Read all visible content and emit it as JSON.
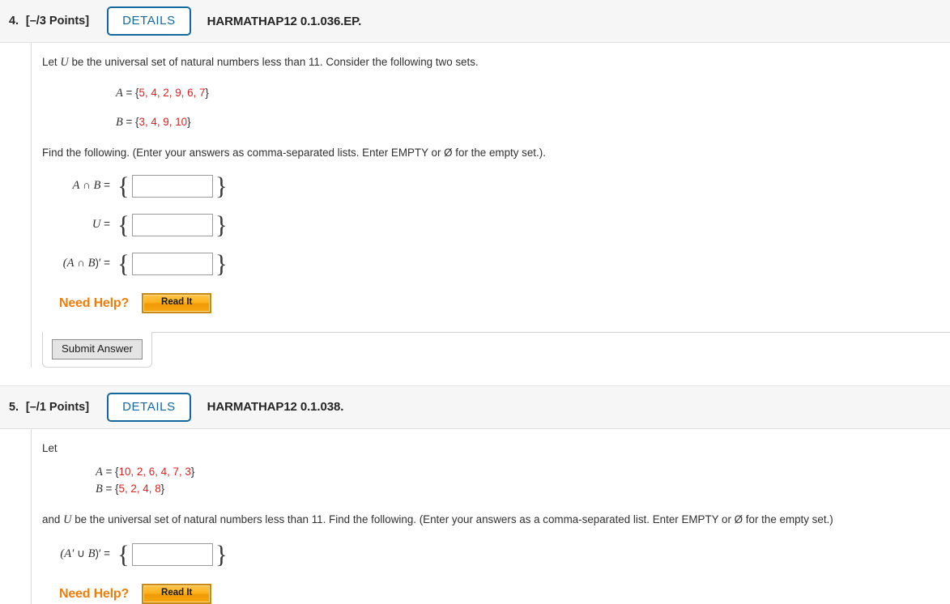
{
  "questions": [
    {
      "number": "4.",
      "points": "[–/3 Points]",
      "details_label": "DETAILS",
      "code": "HARMATHAP12 0.1.036.EP.",
      "intro": "Let ",
      "intro_var": "U",
      "intro_rest": " be the universal set of natural numbers less than 11. Consider the following two sets.",
      "set_a_name": "A",
      "set_a_eq": " = {",
      "set_a_values": "5, 4, 2, 9, 6, 7",
      "set_close": "}",
      "set_b_name": "B",
      "set_b_values": "3, 4, 9, 10",
      "instruction": "Find the following. (Enter your answers as comma-separated lists. Enter EMPTY or Ø for the empty set.).",
      "answers": [
        {
          "label_pre": "A",
          "label_op": " ∩ ",
          "label_mid": "B",
          "label_post": " =",
          "value": "",
          "placeholder": ""
        },
        {
          "label_pre": "U",
          "label_op": "",
          "label_mid": "",
          "label_post": " =",
          "value": "",
          "placeholder": ""
        },
        {
          "label_pre": "(A",
          "label_op": " ∩ ",
          "label_mid": "B",
          "label_post": ")′ =",
          "value": "",
          "placeholder": ""
        }
      ],
      "need_help_label": "Need Help?",
      "read_it_label": "Read It",
      "submit_label": "Submit Answer"
    },
    {
      "number": "5.",
      "points": "[–/1 Points]",
      "details_label": "DETAILS",
      "code": "HARMATHAP12 0.1.038.",
      "intro": "Let",
      "set_a_name": "A",
      "set_a_eq": " = {",
      "set_a_values": "10, 2, 6, 4, 7, 3",
      "set_close": "}",
      "set_b_name": "B",
      "set_b_values": "5, 2, 4, 8",
      "instruction_pre": "and ",
      "instruction_var": "U",
      "instruction_rest": " be the universal set of natural numbers less than 11. Find the following. (Enter your answers as a comma-separated list. Enter EMPTY or Ø for the empty set.)",
      "answers": [
        {
          "label_pre": "(A′",
          "label_op": " ∪ ",
          "label_mid": "B",
          "label_post": ")′ =",
          "value": "",
          "placeholder": ""
        }
      ],
      "need_help_label": "Need Help?",
      "read_it_label": "Read It"
    }
  ],
  "colors": {
    "set_value": "#e02020",
    "details_blue": "#1368a0",
    "need_help_orange": "#f07d0a",
    "header_bg": "#f6f6f6"
  }
}
